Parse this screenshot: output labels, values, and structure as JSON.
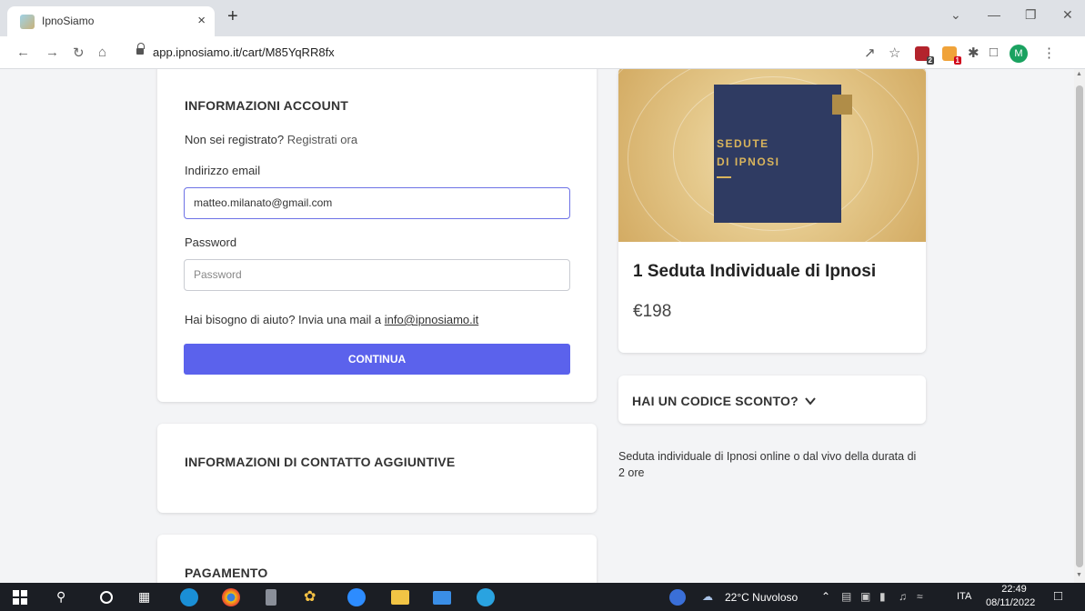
{
  "browser": {
    "tab_title": "IpnoSiamo",
    "tab_close": "×",
    "new_tab": "+",
    "url": "app.ipnosiamo.it/cart/M85YqRR8fx",
    "profile_initial": "M",
    "ext_badge_1": "2",
    "ext_badge_2": "1",
    "icons": [
      "back-icon",
      "forward-icon",
      "reload-icon",
      "home-icon",
      "lock-icon",
      "share-icon",
      "star-icon",
      "extensions-icon",
      "sidebar-icon",
      "menu-icon"
    ]
  },
  "account": {
    "heading": "INFORMAZIONI ACCOUNT",
    "not_registered": "Non sei registrato?",
    "register_link": "Registrati ora",
    "email_label": "Indirizzo email",
    "email_value": "matteo.milanato@gmail.com",
    "password_label": "Password",
    "password_placeholder": "Password",
    "help_text": "Hai bisogno di aiuto? Invia una mail a",
    "help_email": "info@ipnosiamo.it",
    "continue_label": "CONTINUA"
  },
  "contact": {
    "heading": "INFORMAZIONI DI CONTATTO AGGIUNTIVE"
  },
  "payment": {
    "heading": "PAGAMENTO"
  },
  "product": {
    "image_line1": "SEDUTE",
    "image_line2": "DI IPNOSI",
    "title": "1 Seduta Individuale di Ipnosi",
    "price": "€198",
    "discount_label": "HAI UN CODICE SCONTO?",
    "description": "Seduta individuale di Ipnosi online o dal vivo della durata di 2 ore"
  },
  "taskbar": {
    "weather": "22°C Nuvoloso",
    "language": "ITA",
    "time": "22:49",
    "date": "08/11/2022"
  },
  "colors": {
    "accent": "#5b62ec",
    "book": "#2f3b62",
    "gold": "#d9b45c",
    "taskbar": "#1b1e24"
  }
}
